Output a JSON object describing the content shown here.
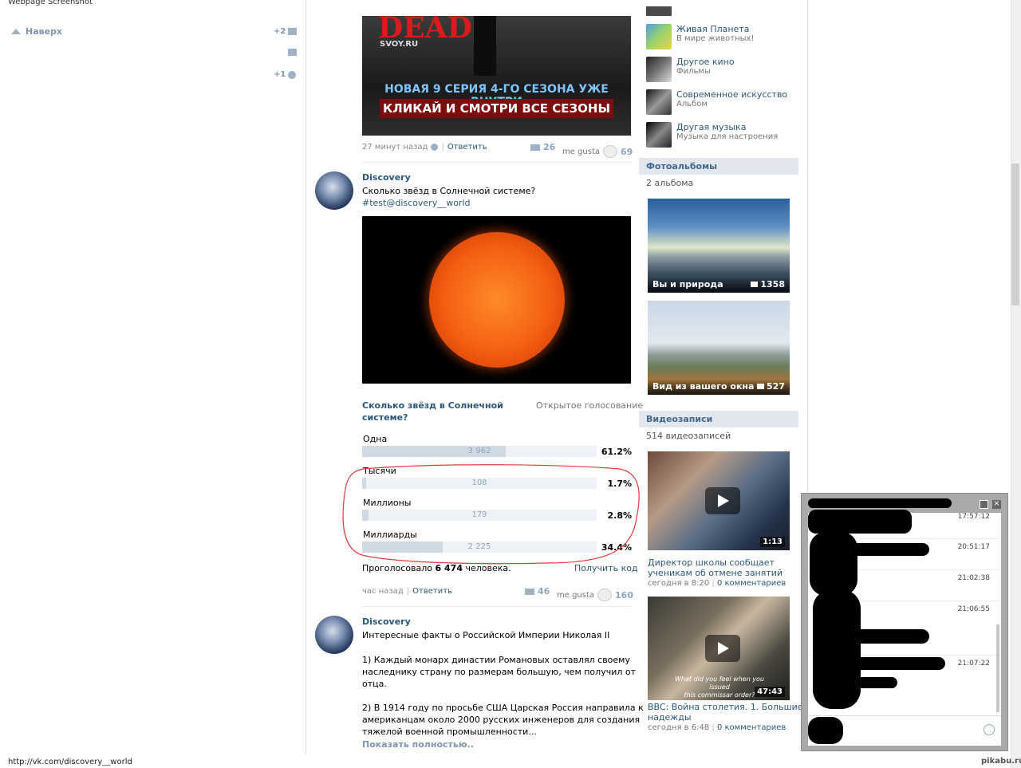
{
  "screenshot_label": "Webpage Screenshot",
  "left_panel": {
    "to_top": "Наверх",
    "counter_mail": "+2",
    "counter_settings": "+1"
  },
  "post1": {
    "banner_title": "DEAD",
    "banner_site": "SVOY.RU",
    "banner_line1": "НОВАЯ 9 СЕРИЯ 4-ГО СЕЗОНА УЖЕ ВНУТРИ",
    "banner_line2": "КЛИКАЙ И СМОТРИ ВСЕ СЕЗОНЫ",
    "time": "27 минут назад",
    "reply": "Ответить",
    "reposts": "26",
    "me_gusta": "me gusta",
    "likes": "69"
  },
  "post2": {
    "author": "Discovery",
    "text": "Сколько звёзд в Солнечной системе?",
    "hashtag": "#test@discovery__world",
    "poll": {
      "question": "Сколько звёзд в Солнечной системе?",
      "type": "Открытое голосование",
      "options": [
        {
          "label": "Одна",
          "count": "3 962",
          "percent": "61.2%",
          "share": 0.612
        },
        {
          "label": "Тысячи",
          "count": "108",
          "percent": "1.7%",
          "share": 0.017
        },
        {
          "label": "Миллионы",
          "count": "179",
          "percent": "2.8%",
          "share": 0.028
        },
        {
          "label": "Миллиарды",
          "count": "2 225",
          "percent": "34.4%",
          "share": 0.344
        }
      ],
      "voted_prefix": "Проголосовало",
      "voted_count": "6 474",
      "voted_suffix": "человека.",
      "get_code": "Получить код"
    },
    "time": "час назад",
    "reply": "Ответить",
    "reposts": "46",
    "me_gusta": "me gusta",
    "likes": "160"
  },
  "post3": {
    "author": "Discovery",
    "text_line1": "Интересные факты о Российской Империи Николая II",
    "p1_l1": "1) Каждый монарх династии Романовых оставлял своему",
    "p1_l2": "наследнику страну по размерам большую, чем получил от",
    "p1_l3": "отца.",
    "p2_l1": "2) В 1914 году по просьбе США Царская Россия направила к",
    "p2_l2": "американцам около 2000 русских инженеров для создания",
    "p2_l3": "тяжелой военной промышленности...",
    "show_more": "Показать полностью.."
  },
  "groups": [
    {
      "title": "Живая Планета",
      "sub": "В мире животных!"
    },
    {
      "title": "Другое кино",
      "sub": "Фильмы"
    },
    {
      "title": "Современное искусство",
      "sub": "Альбом"
    },
    {
      "title": "Другая музыка",
      "sub": "Музыка для настроения"
    }
  ],
  "photo_albums": {
    "head": "Фотоальбомы",
    "sub": "2 альбома",
    "items": [
      {
        "name": "Вы и природа",
        "count": "1358"
      },
      {
        "name": "Вид из вашего окна",
        "count": "527"
      }
    ]
  },
  "videos": {
    "head": "Видеозаписи",
    "sub": "514 видеозаписей",
    "items": [
      {
        "duration": "1:13",
        "title_l1": "Директор школы сообщает",
        "title_l2": "ученикам об отмене занятий",
        "date": "сегодня в 8:20",
        "comments": "0 комментариев"
      },
      {
        "duration": "47:43",
        "overlay_l1": "What did you feel when you issued",
        "overlay_l2": "this commissar order?",
        "title_l1": "BBC: Война столетия. 1. Большие",
        "title_l2": "надежды",
        "date": "сегодня в 6:48",
        "comments": "0 комментариев"
      }
    ]
  },
  "chat": {
    "times": [
      "17:57:12",
      "20:51:17",
      "21:02:38",
      "21:06:55",
      "21:07:22"
    ]
  },
  "status_url": "http://vk.com/discovery__world",
  "watermark": "pikabu.ru"
}
